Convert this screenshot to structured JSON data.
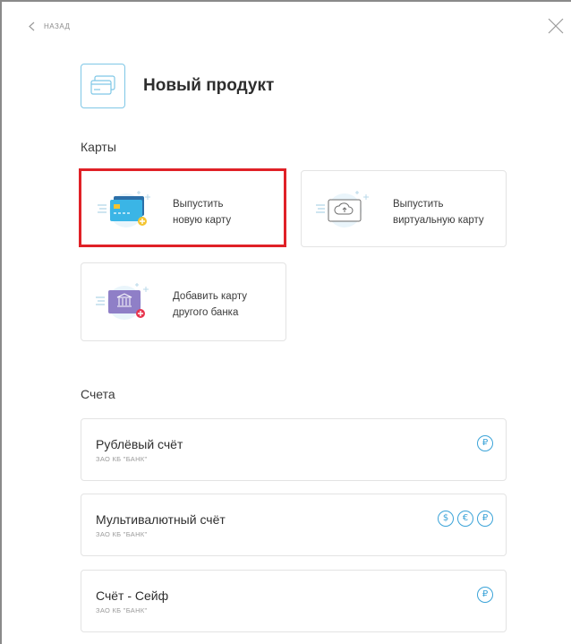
{
  "nav": {
    "back_label": "НАЗАД"
  },
  "header": {
    "title": "Новый продукт"
  },
  "sections": {
    "cards_title": "Карты",
    "accounts_title": "Счета"
  },
  "cards": [
    {
      "label_line1": "Выпустить",
      "label_line2": "новую карту",
      "icon": "new-card-icon",
      "selected": true
    },
    {
      "label_line1": "Выпустить",
      "label_line2": "виртуальную карту",
      "icon": "virtual-card-icon",
      "selected": false
    },
    {
      "label_line1": "Добавить карту",
      "label_line2": "другого банка",
      "icon": "other-bank-card-icon",
      "selected": false
    }
  ],
  "accounts": [
    {
      "name": "Рублёвый счёт",
      "bank": "ЗАО КБ \"БАНК\"",
      "currencies": [
        "₽"
      ]
    },
    {
      "name": "Мультивалютный счёт",
      "bank": "ЗАО КБ \"БАНК\"",
      "currencies": [
        "$",
        "€",
        "₽"
      ]
    },
    {
      "name": "Счёт - Сейф",
      "bank": "ЗАО КБ \"БАНК\"",
      "currencies": [
        "₽"
      ]
    }
  ],
  "colors": {
    "accent": "#3aa3d8",
    "highlight": "#e02127",
    "border": "#e3e3e3"
  }
}
